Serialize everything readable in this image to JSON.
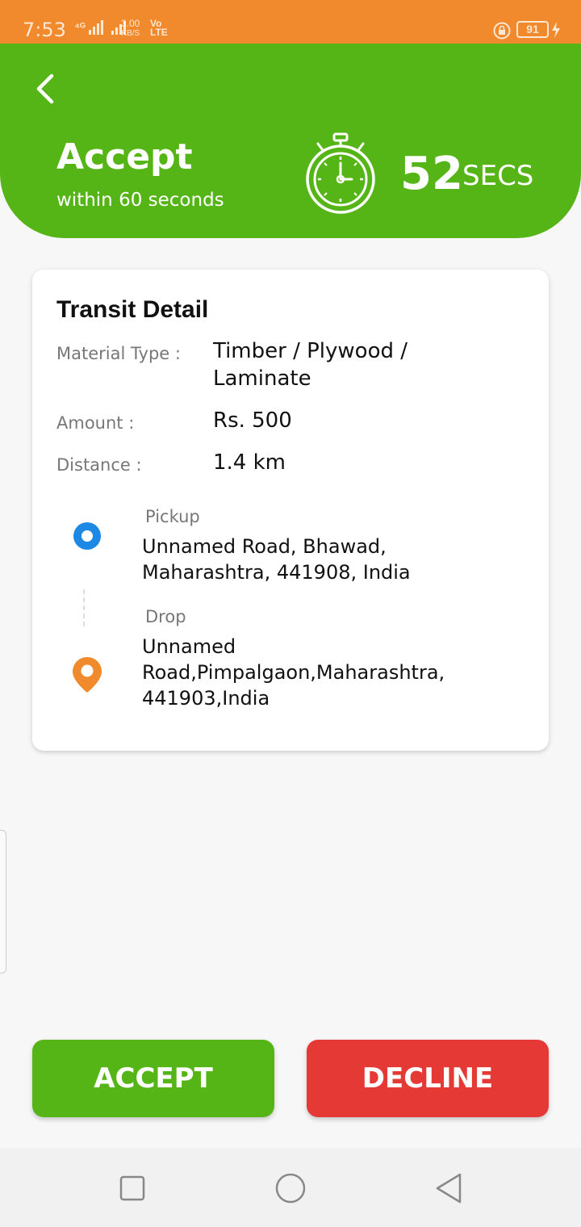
{
  "status_bar": {
    "time": "7:53",
    "signal_text": "⁴ᴳ",
    "speed_value": "3.00",
    "speed_unit": "KB/S",
    "volte_line1": "Vo",
    "volte_line2": "LTE",
    "battery": "91",
    "icons": [
      "lock-icon",
      "battery-icon",
      "bolt-icon"
    ]
  },
  "header": {
    "title": "Accept",
    "subtitle": "within 60 seconds",
    "timer_value": "52",
    "timer_unit": "SECS",
    "back_icon": "chevron-left-icon",
    "timer_icon": "stopwatch-icon"
  },
  "transit": {
    "title": "Transit Detail",
    "material_label": "Material Type :",
    "material_value_line1": "Timber / Plywood /",
    "material_value_line2": "Laminate",
    "amount_label": "Amount :",
    "amount_value": "Rs. 500",
    "distance_label": "Distance :",
    "distance_value": "1.4 km",
    "pickup_label": "Pickup",
    "pickup_line1": "Unnamed Road, Bhawad,",
    "pickup_line2": "Maharashtra, 441908, India",
    "drop_label": "Drop",
    "drop_line1": "Unnamed",
    "drop_line2": "Road,Pimpalgaon,Maharashtra,",
    "drop_line3": "441903,India"
  },
  "actions": {
    "accept_label": "ACCEPT",
    "decline_label": "DECLINE"
  },
  "colors": {
    "status_bar": "#f08a2c",
    "primary_green": "#56b516",
    "decline_red": "#e53935",
    "pickup_blue": "#1e88e5",
    "drop_orange": "#f08a2c"
  },
  "nav_bar": {
    "icons": [
      "recents-square-icon",
      "home-circle-icon",
      "back-triangle-icon"
    ]
  }
}
